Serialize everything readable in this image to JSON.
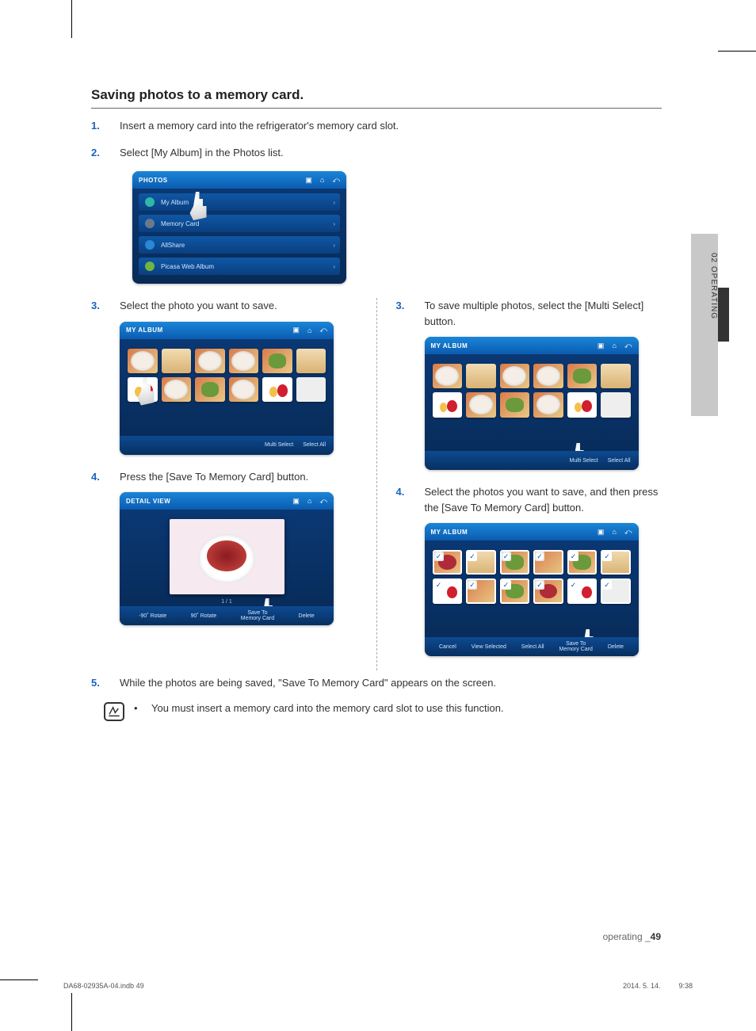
{
  "section_title": "Saving photos to a memory card.",
  "steps": {
    "s1_num": "1.",
    "s1_text": "Insert a memory card into the refrigerator's memory card slot.",
    "s2_num": "2.",
    "s2_text": "Select [My Album] in the Photos list.",
    "left3_num": "3.",
    "left3_text": "Select the photo you want to save.",
    "left4_num": "4.",
    "left4_text": "Press the [Save To Memory Card] button.",
    "right3_num": "3.",
    "right3_text": "To save multiple photos, select the [Multi Select] button.",
    "right4_num": "4.",
    "right4_text": "Select the photos you want to save, and then press the [Save To Memory Card] button.",
    "s5_num": "5.",
    "s5_text": "While the photos are being saved, \"Save To Memory Card\" appears on the screen.",
    "note_bullet": "•",
    "note_text": "You must insert a memory card into the memory card slot to use this function."
  },
  "screenshots": {
    "photos_list": {
      "title": "PHOTOS",
      "items": [
        "My Album",
        "Memory Card",
        "AllShare",
        "Picasa Web Album"
      ]
    },
    "album_grid": {
      "title": "MY ALBUM",
      "footer": [
        "Multi Select",
        "Select All"
      ]
    },
    "detail_view": {
      "title": "DETAIL VIEW",
      "page": "1 / 1",
      "footer": [
        "-90˚ Rotate",
        "90˚ Rotate",
        "Save To\nMemory Card",
        "Delete"
      ]
    },
    "multi_select": {
      "title": "MY ALBUM",
      "footer": [
        "Cancel",
        "View Selected",
        "Select All",
        "Save To\nMemory Card",
        "Delete"
      ]
    }
  },
  "side_tab": "02  OPERATING",
  "footer": {
    "label": "operating _",
    "page": "49",
    "file": "DA68-02935A-04.indb   49",
    "date": "2014. 5. 14.      9:38"
  }
}
